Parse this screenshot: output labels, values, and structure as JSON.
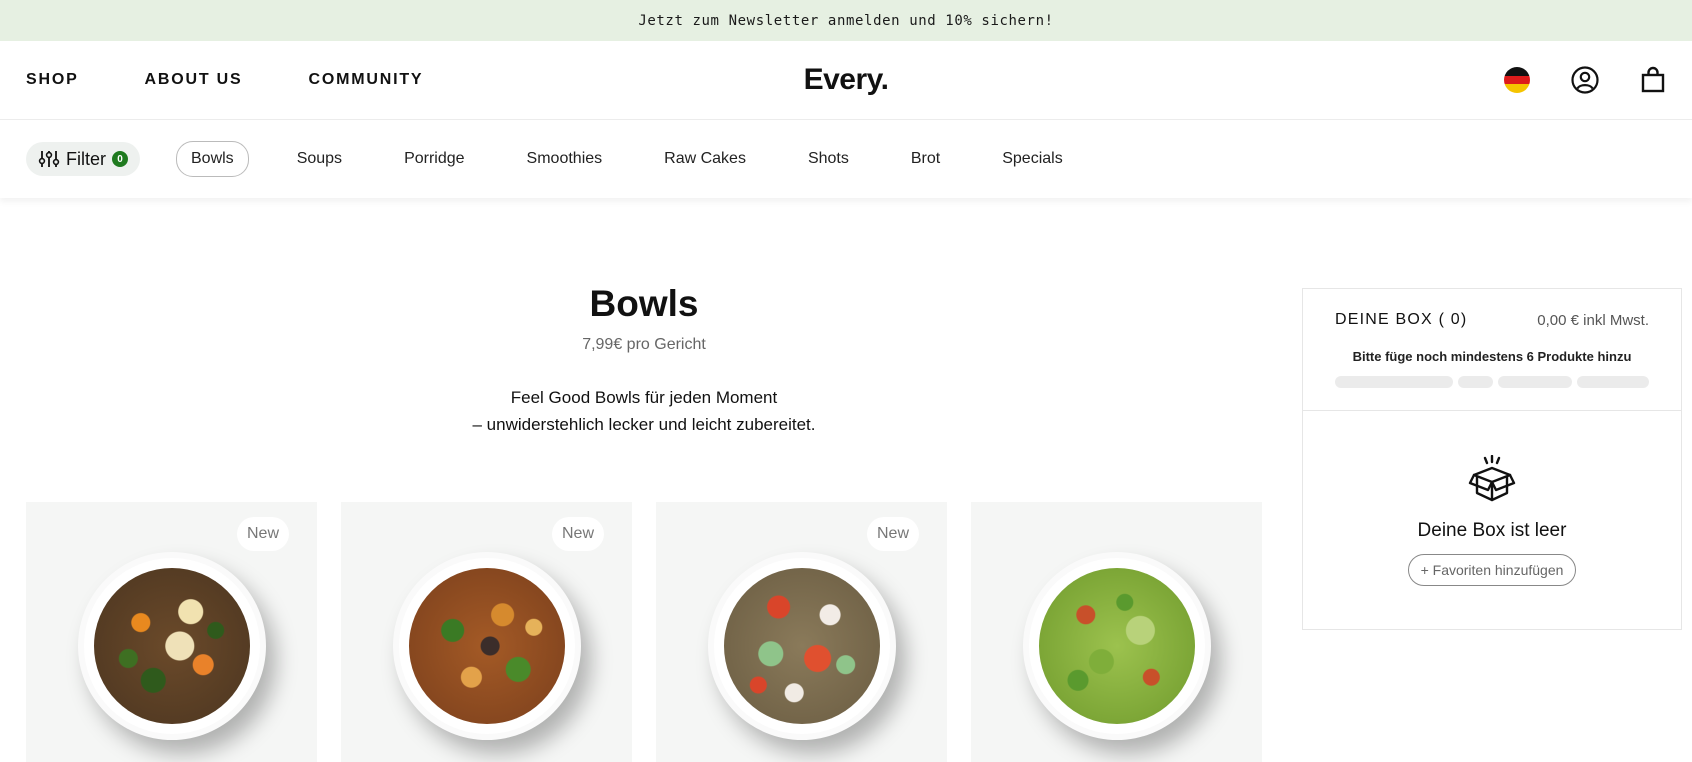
{
  "announcement": {
    "text": "Jetzt zum Newsletter anmelden und 10% sichern!"
  },
  "header": {
    "nav": [
      "SHOP",
      "ABOUT US",
      "COMMUNITY"
    ],
    "logo": "Every.",
    "icons": [
      "germany-flag-icon",
      "user-account-icon",
      "shopping-bag-icon"
    ]
  },
  "filterbar": {
    "filter_label": "Filter",
    "filter_count": "0",
    "categories": [
      "Bowls",
      "Soups",
      "Porridge",
      "Smoothies",
      "Raw Cakes",
      "Shots",
      "Brot",
      "Specials"
    ],
    "active_category": "Bowls"
  },
  "hero": {
    "title": "Bowls",
    "price": "7,99€ pro Gericht",
    "desc_line1": "Feel Good Bowls für jeden Moment",
    "desc_line2": "– unwiderstehlich lecker und leicht zubereitet."
  },
  "products": [
    {
      "badge": "New",
      "bowl": "pumpkin-cauliflower-kale-bowl"
    },
    {
      "badge": "New",
      "bowl": "chickpea-broccoli-bowl"
    },
    {
      "badge": "New",
      "bowl": "tomato-mushroom-cucumber-bowl"
    },
    {
      "badge": "",
      "bowl": "pea-pasta-pesto-bowl"
    }
  ],
  "box": {
    "title": "DEINE BOX ( 0)",
    "total": "0,00 € inkl Mwst.",
    "hint": "Bitte füge noch mindestens 6 Produkte hinzu",
    "progress": 0,
    "empty_label": "Deine Box ist leer",
    "favorites_button": "+ Favoriten hinzufügen"
  },
  "colors": {
    "announcement_bg": "#e6f0e2",
    "filter_badge": "#1f7a1f",
    "card_bg": "#f5f6f5"
  }
}
